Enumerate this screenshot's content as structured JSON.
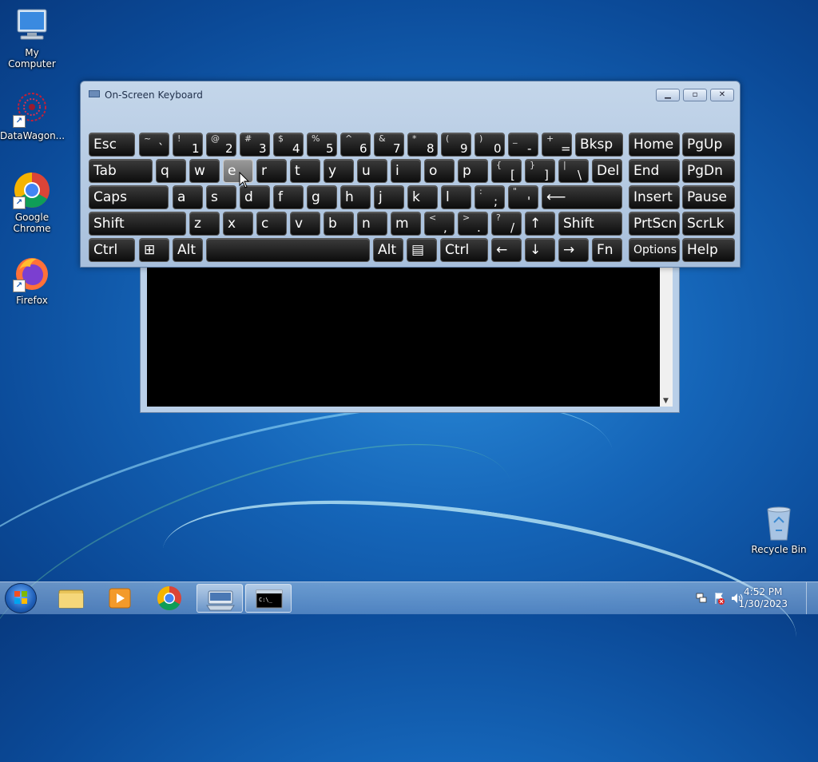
{
  "desktop": {
    "icons": [
      {
        "label": "My Computer"
      },
      {
        "label": "DataWagon..."
      },
      {
        "label": "Google Chrome"
      },
      {
        "label": "Firefox"
      },
      {
        "label": "Recycle Bin"
      }
    ]
  },
  "osk": {
    "title": "On-Screen Keyboard",
    "rows": [
      [
        {
          "main": "Esc"
        },
        {
          "shift": "~",
          "base": "`"
        },
        {
          "shift": "!",
          "base": "1"
        },
        {
          "shift": "@",
          "base": "2"
        },
        {
          "shift": "#",
          "base": "3"
        },
        {
          "shift": "$",
          "base": "4"
        },
        {
          "shift": "%",
          "base": "5"
        },
        {
          "shift": "^",
          "base": "6"
        },
        {
          "shift": "&",
          "base": "7"
        },
        {
          "shift": "*",
          "base": "8"
        },
        {
          "shift": "(",
          "base": "9"
        },
        {
          "shift": ")",
          "base": "0"
        },
        {
          "shift": "_",
          "base": "-"
        },
        {
          "shift": "+",
          "base": "="
        },
        {
          "main": "Bksp"
        },
        {
          "main": "Home"
        },
        {
          "main": "PgUp"
        }
      ],
      [
        {
          "main": "Tab"
        },
        {
          "main": "q"
        },
        {
          "main": "w"
        },
        {
          "main": "e"
        },
        {
          "main": "r"
        },
        {
          "main": "t"
        },
        {
          "main": "y"
        },
        {
          "main": "u"
        },
        {
          "main": "i"
        },
        {
          "main": "o"
        },
        {
          "main": "p"
        },
        {
          "shift": "{",
          "base": "["
        },
        {
          "shift": "}",
          "base": "]"
        },
        {
          "shift": "|",
          "base": "\\"
        },
        {
          "main": "Del"
        },
        {
          "main": "End"
        },
        {
          "main": "PgDn"
        }
      ],
      [
        {
          "main": "Caps"
        },
        {
          "main": "a"
        },
        {
          "main": "s"
        },
        {
          "main": "d"
        },
        {
          "main": "f"
        },
        {
          "main": "g"
        },
        {
          "main": "h"
        },
        {
          "main": "j"
        },
        {
          "main": "k"
        },
        {
          "main": "l"
        },
        {
          "shift": ":",
          "base": ";"
        },
        {
          "shift": "\"",
          "base": "'"
        },
        {
          "main": "⟵"
        },
        {
          "main": "Insert"
        },
        {
          "main": "Pause"
        }
      ],
      [
        {
          "main": "Shift"
        },
        {
          "main": "z"
        },
        {
          "main": "x"
        },
        {
          "main": "c"
        },
        {
          "main": "v"
        },
        {
          "main": "b"
        },
        {
          "main": "n"
        },
        {
          "main": "m"
        },
        {
          "shift": "<",
          "base": ","
        },
        {
          "shift": ">",
          "base": "."
        },
        {
          "shift": "?",
          "base": "/"
        },
        {
          "main": "↑"
        },
        {
          "main": "Shift"
        },
        {
          "main": "PrtScn"
        },
        {
          "main": "ScrLk"
        }
      ],
      [
        {
          "main": "Ctrl"
        },
        {
          "main": "⊞"
        },
        {
          "main": "Alt"
        },
        {
          "main": ""
        },
        {
          "main": "Alt"
        },
        {
          "main": "▤"
        },
        {
          "main": "Ctrl"
        },
        {
          "main": "←"
        },
        {
          "main": "↓"
        },
        {
          "main": "→"
        },
        {
          "main": "Fn"
        },
        {
          "main": "Options"
        },
        {
          "main": "Help"
        }
      ]
    ],
    "hovered_key": "e"
  },
  "taskbar": {
    "time": "4:52 PM",
    "date": "1/30/2023",
    "apps": [
      "explorer",
      "media-player",
      "chrome",
      "on-screen-keyboard",
      "command-prompt"
    ]
  }
}
